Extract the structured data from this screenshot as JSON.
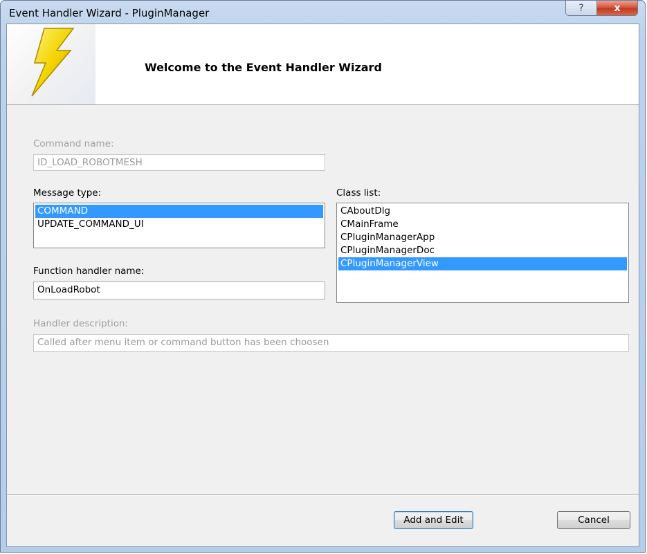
{
  "window": {
    "title": "Event Handler Wizard - PluginManager",
    "help_glyph": "?",
    "close_glyph": "x"
  },
  "banner": {
    "welcome": "Welcome to the Event Handler Wizard",
    "logo_icon": "lightning-bolt-icon"
  },
  "command": {
    "label": "Command name:",
    "value": "ID_LOAD_ROBOTMESH"
  },
  "message_type": {
    "label": "Message type:",
    "items": [
      "COMMAND",
      "UPDATE_COMMAND_UI"
    ],
    "selected": "COMMAND"
  },
  "class_list": {
    "label": "Class list:",
    "items": [
      "CAboutDlg",
      "CMainFrame",
      "CPluginManagerApp",
      "CPluginManagerDoc",
      "CPluginManagerView"
    ],
    "selected": "CPluginManagerView"
  },
  "function_handler": {
    "label": "Function handler name:",
    "value": "OnLoadRobot"
  },
  "handler_description": {
    "label": "Handler description:",
    "value": "Called after menu item or command button has been choosen"
  },
  "buttons": {
    "add_edit": "Add and Edit",
    "cancel": "Cancel"
  },
  "colors": {
    "selection": "#3399ff",
    "bolt": "#f3d400"
  }
}
